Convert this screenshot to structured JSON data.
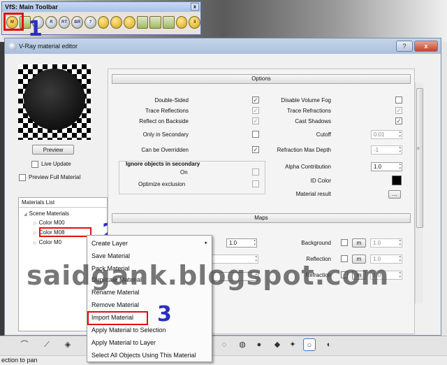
{
  "toolbar": {
    "title": "VfS: Main Toolbar",
    "close": "x",
    "icons": [
      "M",
      "",
      "",
      "R",
      "RT",
      "BR",
      "?",
      "",
      "",
      "",
      "",
      "",
      "",
      "",
      "II"
    ],
    "icon_names": [
      "material-editor-icon",
      "options-icon",
      "render-icon",
      "rt-render-icon",
      "batch-render-icon",
      "frame-buffer-icon",
      "help-icon",
      "tag-icon",
      "camera-icon",
      "plane-icon",
      "omni-light-icon",
      "spot-light-icon",
      "rect-light-icon",
      "sphere-light-icon",
      "pause-icon"
    ]
  },
  "annotations": {
    "step1": "1",
    "step2": "2",
    "step3": "3"
  },
  "window": {
    "title": "V-Ray material editor",
    "help": "?",
    "close": "x"
  },
  "preview": {
    "button": "Preview",
    "live_update": "Live Update",
    "live_update_checked": false,
    "full_material": "Preview Full Material",
    "full_material_checked": false
  },
  "materials_list": {
    "title": "Materials List",
    "root": "Scene Materials",
    "items": [
      "Color M00",
      "Color M08",
      "Color M0"
    ]
  },
  "options": {
    "title": "Options",
    "left": [
      {
        "label": "Double-Sided",
        "checked": true,
        "enabled": true
      },
      {
        "label": "Trace Reflections",
        "checked": true,
        "enabled": false
      },
      {
        "label": "Reflect on Backside",
        "checked": true,
        "enabled": false
      },
      {
        "label": "Only in Secondary",
        "checked": false,
        "enabled": true
      },
      {
        "label": "Can be Overridden",
        "checked": true,
        "enabled": true
      }
    ],
    "right": [
      {
        "label": "Disable Volume Fog",
        "checked": false
      },
      {
        "label": "Trace Refractions",
        "checked": true
      },
      {
        "label": "Cast Shadows",
        "checked": true
      }
    ],
    "cutoff_label": "Cutoff",
    "cutoff_value": "0.01",
    "refraction_depth_label": "Refraction Max Depth",
    "refraction_depth_value": "-1",
    "alpha_label": "Alpha Contribution",
    "alpha_value": "1.0",
    "id_color_label": "ID Color",
    "id_color": "#000000",
    "material_result_label": "Material result",
    "material_result_button": "...",
    "ignore_group": {
      "title": "Ignore objects in secondary",
      "on_label": "On",
      "optimize_label": "Optimize exclusion"
    }
  },
  "maps": {
    "title": "Maps",
    "left_spinner": "1.0",
    "rows": [
      {
        "label": "Background",
        "button": "m",
        "value": "1.0"
      },
      {
        "label": "Reflection",
        "button": "m",
        "value": "1.0"
      },
      {
        "label": "Refraction",
        "button": "m",
        "value": "1.0"
      }
    ]
  },
  "context_menu": {
    "items": [
      "Create Layer",
      "Save Material",
      "Pack Material",
      "Duplicate Material",
      "Rename Material",
      "Remove Material",
      "Import Material",
      "Apply Material to Selection",
      "Apply Material to Layer",
      "Select All Objects Using This Material"
    ],
    "submenu_arrow": "▸"
  },
  "status": {
    "text": "ection to pan"
  },
  "watermark": "saidgank.blogspot.com",
  "colors": {
    "highlight": "#e01010",
    "step_number": "#2b2fbf"
  }
}
